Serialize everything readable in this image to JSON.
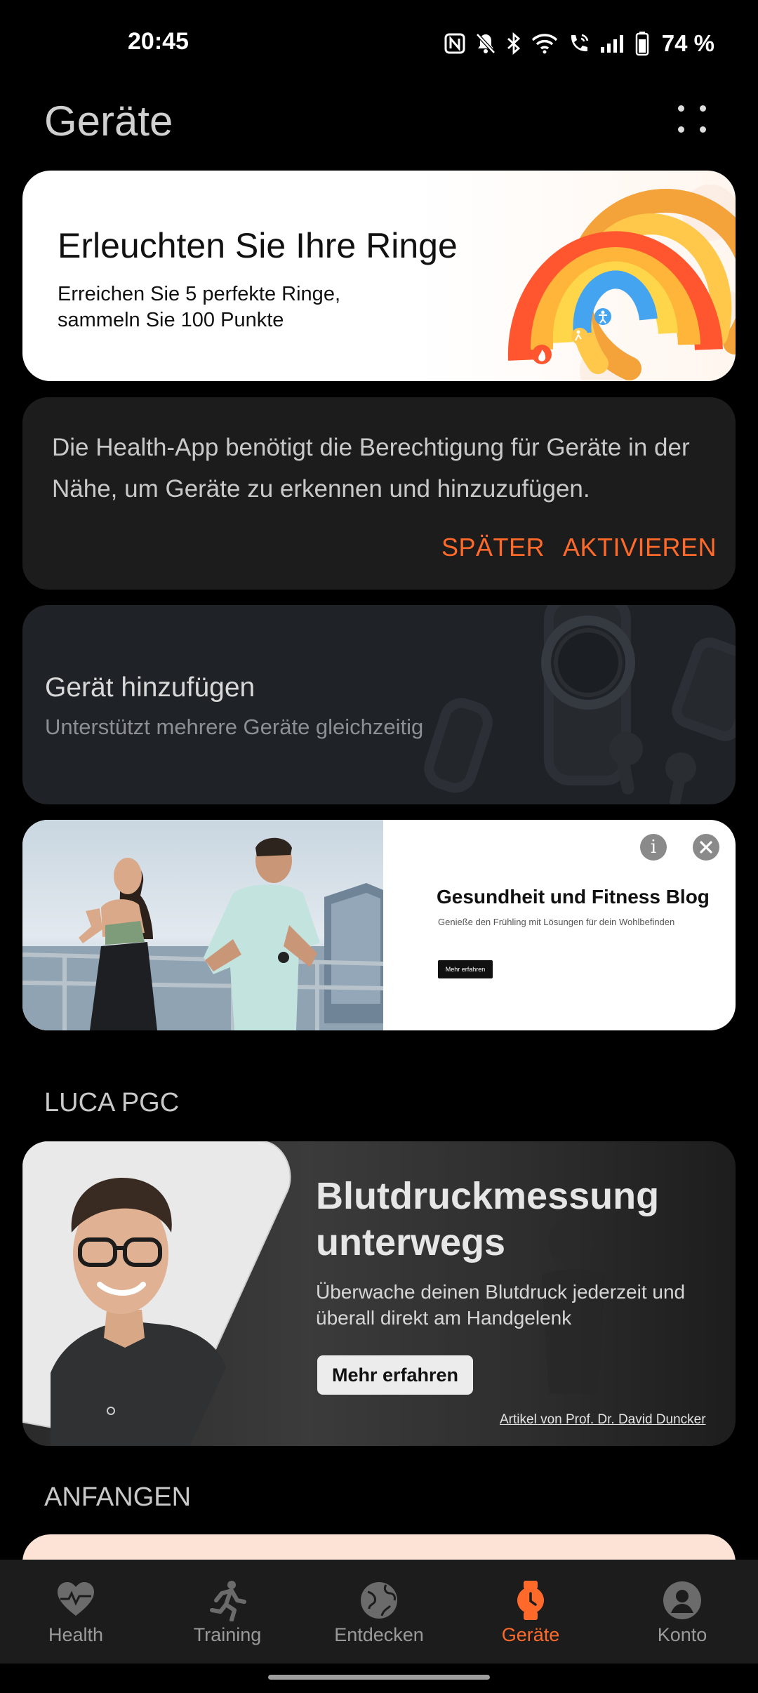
{
  "status_bar": {
    "time": "20:45",
    "icons": [
      "nfc-icon",
      "notifications-off-icon",
      "bluetooth-icon",
      "wifi-icon",
      "wifi-calling-icon",
      "signal-icon",
      "battery-icon"
    ],
    "battery": "74 %"
  },
  "header": {
    "title": "Geräte",
    "more_icon": "more-dots-icon"
  },
  "rings_card": {
    "title": "Erleuchten Sie Ihre Ringe",
    "subtitle": "Erreichen Sie 5 perfekte Ringe, sammeln Sie 100 Punkte"
  },
  "permission_card": {
    "text": "Die Health-App benötigt die Berechtigung für Geräte in der Nähe, um Geräte zu erkennen und hinzuzufügen.",
    "later_label": "SPÄTER",
    "activate_label": "AKTIVIEREN"
  },
  "add_device_card": {
    "title": "Gerät hinzufügen",
    "subtitle": "Unterstützt mehrere Geräte gleichzeitig"
  },
  "ad_card": {
    "title": "Gesundheit und Fitness Blog",
    "description": "Genieße den Frühling mit Lösungen für dein Wohlbefinden",
    "button_label": "Mehr erfahren",
    "info_glyph": "i"
  },
  "luca_section": {
    "header": "LUCA PGC",
    "title": "Blutdruckmessung unterwegs",
    "text": "Überwache deinen Blutdruck jederzeit und überall direkt am Handgelenk",
    "button_label": "Mehr erfahren",
    "credit": "Artikel von Prof. Dr. David Duncker"
  },
  "start_section": {
    "header": "ANFANGEN"
  },
  "bottom_nav": {
    "items": [
      {
        "label": "Health",
        "icon": "heart-pulse-icon"
      },
      {
        "label": "Training",
        "icon": "runner-icon"
      },
      {
        "label": "Entdecken",
        "icon": "globe-icon"
      },
      {
        "label": "Geräte",
        "icon": "watch-icon"
      },
      {
        "label": "Konto",
        "icon": "person-icon"
      }
    ],
    "active_index": 3,
    "active_color": "#ff6a2a"
  }
}
